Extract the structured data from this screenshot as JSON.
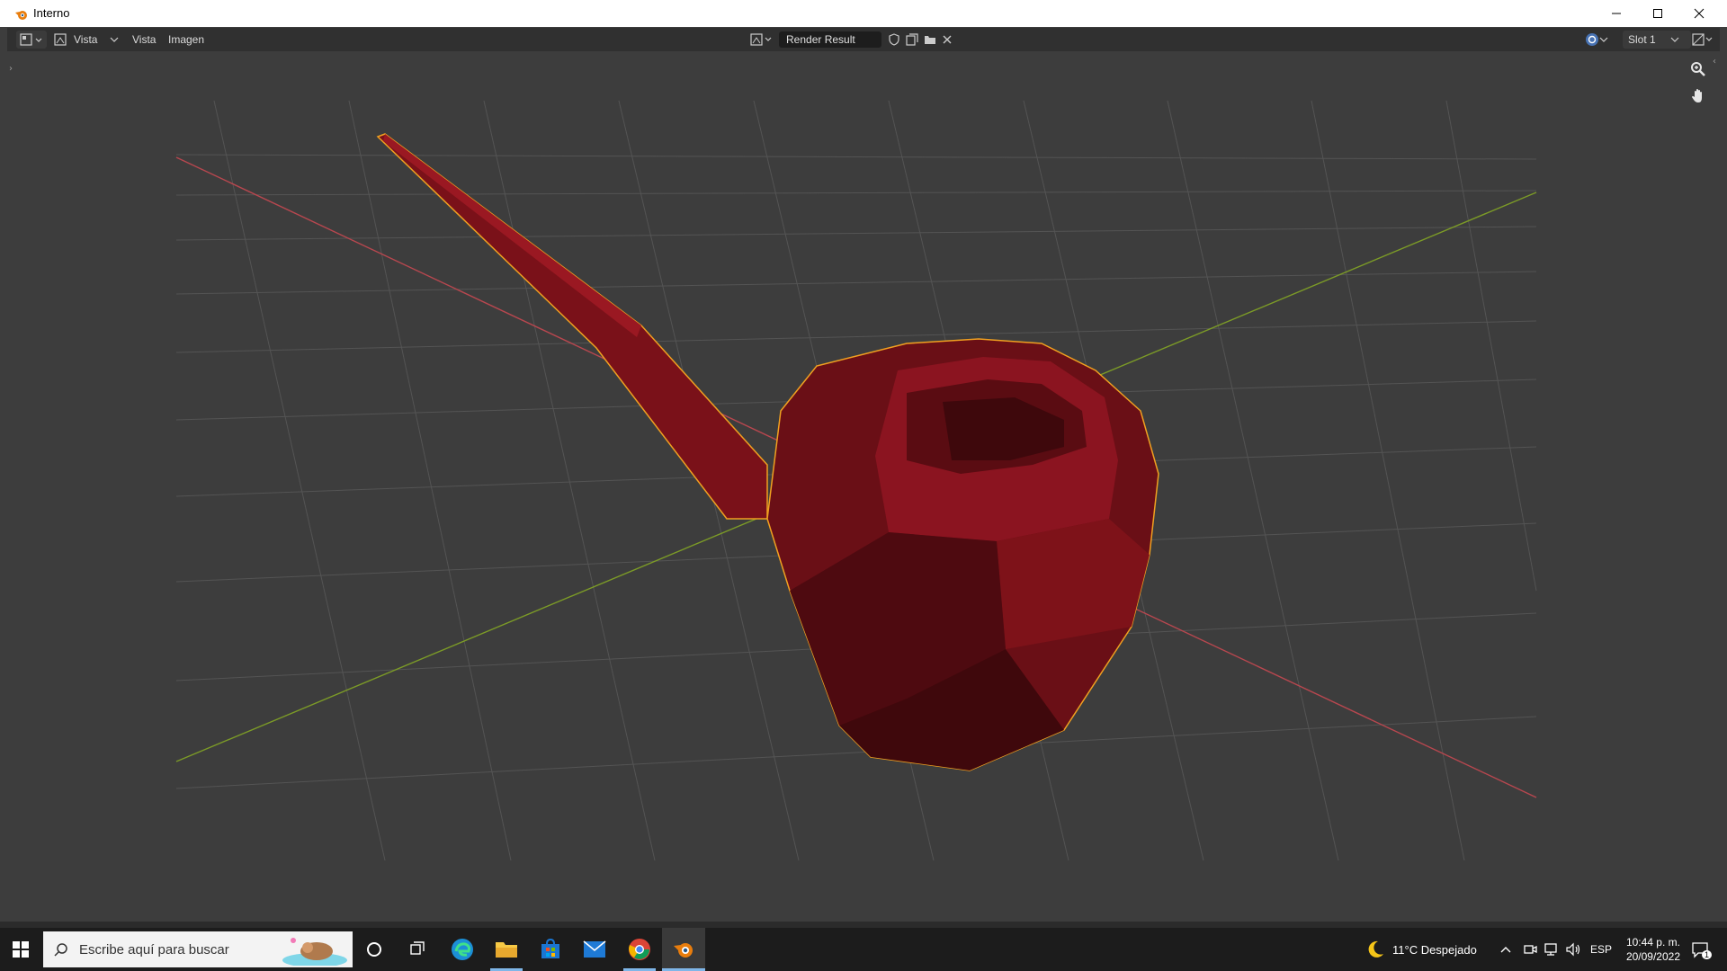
{
  "window": {
    "title": "Interno"
  },
  "header": {
    "view_dropdown": "Vista",
    "menus": [
      "Vista",
      "Imagen"
    ],
    "image_name": "Render Result",
    "slot": "Slot 1"
  },
  "taskbar": {
    "search_placeholder": "Escribe aquí para buscar",
    "weather": "11°C  Despejado",
    "language": "ESP",
    "time": "10:44 p. m.",
    "date": "20/09/2022",
    "notification_count": "1"
  },
  "colors": {
    "object_red": "#8b1420",
    "selection_outline": "#f0a020",
    "x_axis": "#b8474f",
    "y_axis": "#7c9b27",
    "grid": "#545454"
  }
}
